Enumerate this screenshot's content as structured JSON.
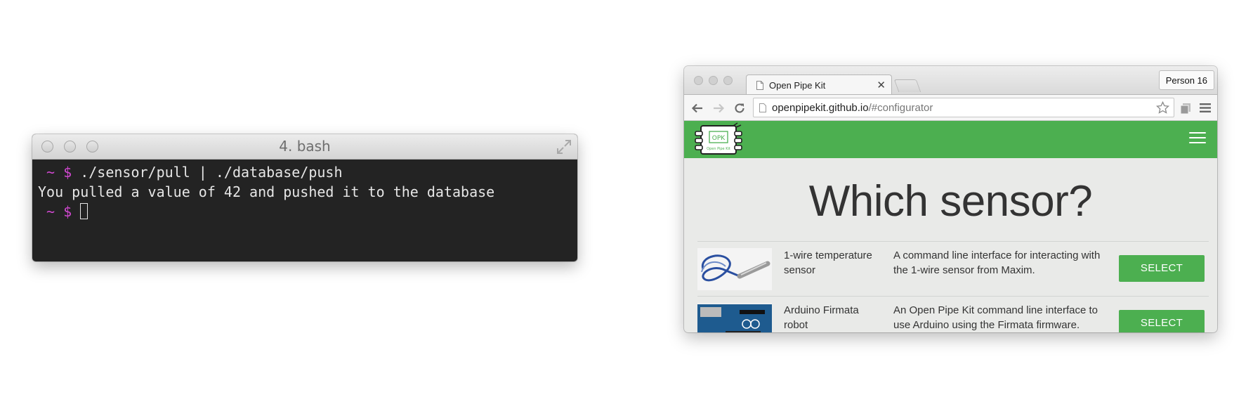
{
  "terminal": {
    "title": "4. bash",
    "lines": [
      {
        "prompt": " ~ $ ",
        "text": "./sensor/pull | ./database/push"
      },
      {
        "prompt": "",
        "text": "You pulled a value of 42 and pushed it to the database"
      },
      {
        "prompt": " ~ $ ",
        "text": ""
      }
    ],
    "prompt_color": "#d048d0"
  },
  "browser": {
    "tab_title": "Open Pipe Kit",
    "profile_button": "Person 16",
    "url_host": "openpipekit.github.io",
    "url_path": "/#configurator",
    "brand_color": "#4caf50",
    "logo_text": "OPK",
    "logo_caption": "Open Pipe Kit",
    "headline": "Which sensor?",
    "sensors": [
      {
        "name": "1-wire temperature sensor",
        "description": "A command line interface for interacting with the 1-wire sensor from Maxim.",
        "button": "SELECT"
      },
      {
        "name": "Arduino Firmata robot",
        "description": "An Open Pipe Kit command line interface to use Arduino using the Firmata firmware.",
        "button": "SELECT"
      }
    ]
  }
}
